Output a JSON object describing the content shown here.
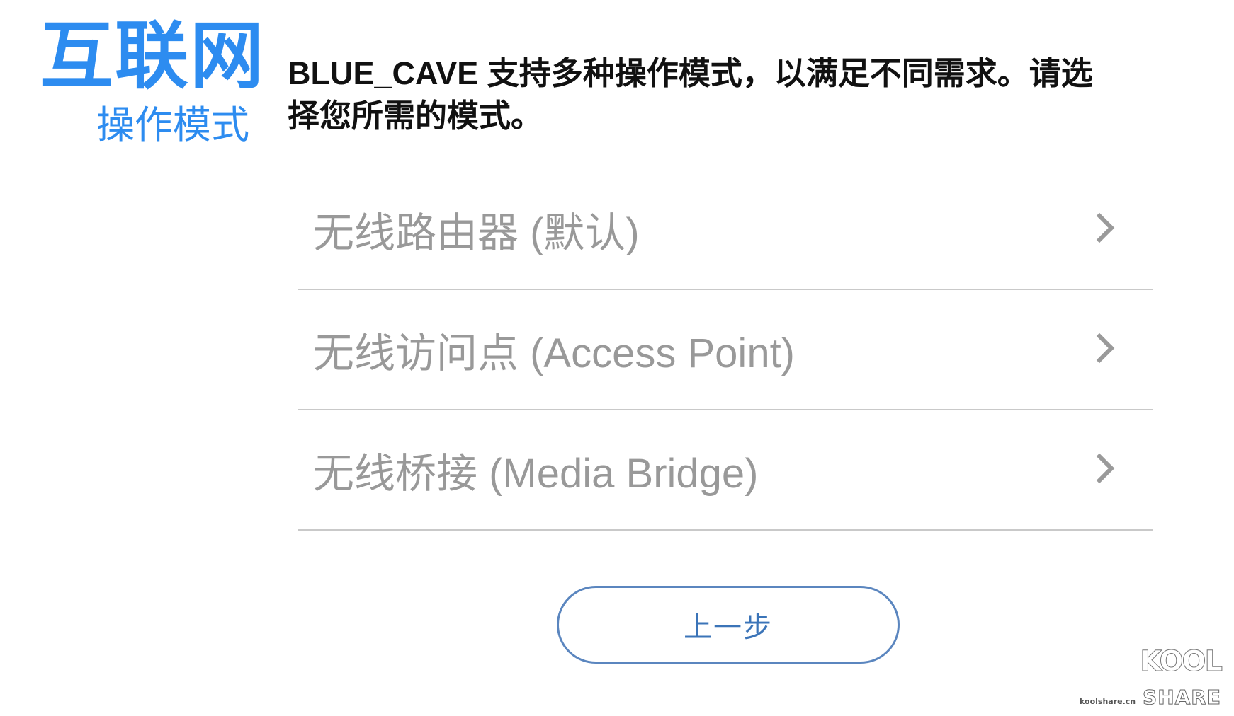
{
  "header": {
    "brand_title": "互联网",
    "brand_subtitle": "操作模式",
    "description": "BLUE_CAVE 支持多种操作模式，以满足不同需求。请选择您所需的模式。"
  },
  "modes": [
    {
      "label": "无线路由器 (默认)",
      "icon": "chevron-right-icon"
    },
    {
      "label": "无线访问点 (Access Point)",
      "icon": "chevron-right-icon"
    },
    {
      "label": "无线桥接 (Media Bridge)",
      "icon": "chevron-right-icon"
    }
  ],
  "footer": {
    "back_label": "上一步"
  },
  "watermark": {
    "top": "KOOL",
    "domain": "koolshare.cn",
    "bottom": "SHARE"
  },
  "colors": {
    "brand": "#2d8cf0",
    "button_border": "#5b86bf",
    "list_text": "#999999",
    "divider": "#c9c9c9"
  }
}
